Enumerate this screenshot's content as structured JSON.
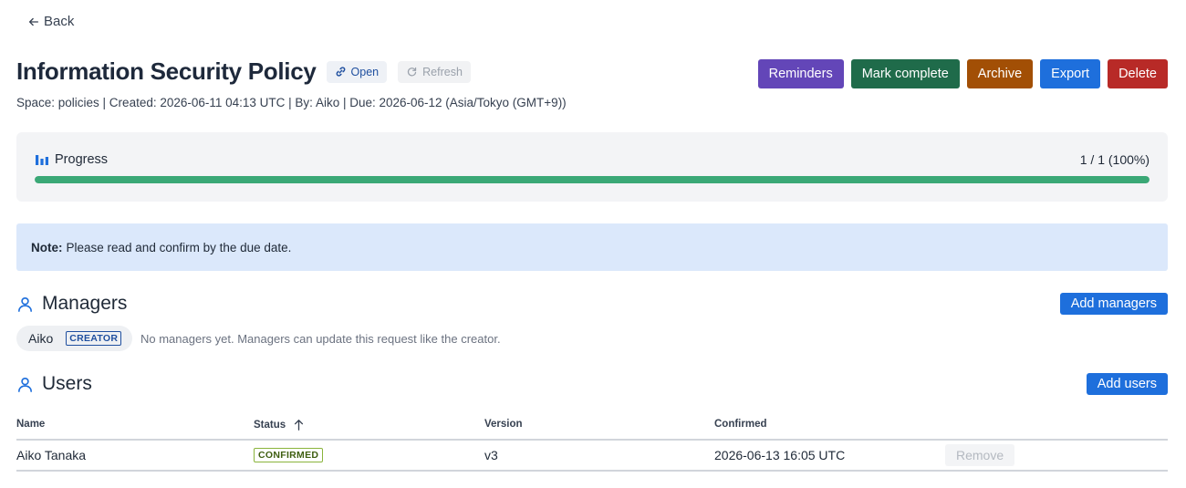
{
  "nav": {
    "back_label": "Back"
  },
  "header": {
    "title": "Information Security Policy",
    "open_label": "Open",
    "refresh_label": "Refresh",
    "meta": "Space: policies | Created: 2026-06-11 04:13 UTC | By: Aiko | Due: 2026-06-12 (Asia/Tokyo (GMT+9))"
  },
  "actions": {
    "reminders": "Reminders",
    "mark_complete": "Mark complete",
    "archive": "Archive",
    "export": "Export",
    "delete": "Delete"
  },
  "progress": {
    "label": "Progress",
    "count_text": "1 / 1 (100%)",
    "fraction": 1.0
  },
  "note": {
    "prefix": "Note:",
    "text": "Please read and confirm by the due date."
  },
  "managers": {
    "title": "Managers",
    "add_label": "Add managers",
    "creator_name": "Aiko",
    "creator_badge": "CREATOR",
    "empty_text": "No managers yet. Managers can update this request like the creator."
  },
  "users": {
    "title": "Users",
    "add_label": "Add users",
    "columns": {
      "name": "Name",
      "status": "Status",
      "version": "Version",
      "confirmed": "Confirmed"
    },
    "rows": [
      {
        "name": "Aiko Tanaka",
        "status": "CONFIRMED",
        "version": "v3",
        "confirmed": "2026-06-13 16:05 UTC",
        "remove_label": "Remove"
      }
    ]
  },
  "colors": {
    "reminders": "#6346b8",
    "mark_complete": "#1f6b4a",
    "archive": "#a24f05",
    "export": "#1e6fdc",
    "delete": "#b82a27",
    "progress_fill": "#3aa876",
    "note_bg": "#dbe8fb"
  },
  "icons": {
    "back": "arrow-left-icon",
    "open": "link-icon",
    "refresh": "refresh-icon",
    "progress": "bar-chart-icon",
    "section": "user-icon",
    "sort": "arrow-up-icon"
  }
}
